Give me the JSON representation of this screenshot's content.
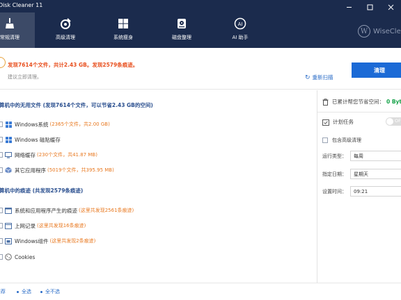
{
  "app": {
    "title": "Disk Cleaner 11"
  },
  "nav": {
    "tabs": [
      {
        "label": "常规清理",
        "icon": "broom-icon"
      },
      {
        "label": "高级清理",
        "icon": "advanced-clean-icon"
      },
      {
        "label": "系统瘦身",
        "icon": "windows-icon"
      },
      {
        "label": "磁盘整理",
        "icon": "disk-icon"
      },
      {
        "label": "AI 助手",
        "icon": "ai-assistant-icon"
      }
    ]
  },
  "brand": {
    "logo_letter": "W",
    "text": "WiseCle"
  },
  "summary": {
    "main": "发现7614个文件，共计2.43 GB。发现2579条痕迹。",
    "sub": "建议立即清理。",
    "rescan_label": "重新扫描",
    "clean_label": "清理"
  },
  "sections": {
    "junk": {
      "title": "算机中的无用文件 (发现7614个文件，可以节省2.43 GB的空间)",
      "items": [
        {
          "name": "Windows系统",
          "detail": "(2365个文件，共2.00 GB)"
        },
        {
          "name": "Windows 磁贴缓存",
          "detail": ""
        },
        {
          "name": "网络缓存",
          "detail": "(230个文件，共41.87 MB)"
        },
        {
          "name": "其它应用程序",
          "detail": "(5019个文件，共395.95 MB)"
        }
      ]
    },
    "traces": {
      "title": "算机中的痕迹 (共发现2579条痕迹)",
      "items": [
        {
          "name": "系统和应用程序产生的痕迹",
          "detail": "(这里共发现2561条痕迹)"
        },
        {
          "name": "上网记录",
          "detail": "(这里共发现16条痕迹)"
        },
        {
          "name": "Windows组件",
          "detail": "(这里共发现2条痕迹)"
        },
        {
          "name": "Cookies",
          "detail": ""
        }
      ]
    }
  },
  "right": {
    "savings_label": "已累计帮您节省空间：",
    "savings_value": "0 Bytes",
    "schedule_label": "计划任务",
    "toggle_text": "OFF",
    "advanced_label": "包含高级清理",
    "fields": [
      {
        "label": "运行类型：",
        "value": "每周"
      },
      {
        "label": "指定日期：",
        "value": "星期天"
      },
      {
        "label": "设置时间：",
        "value": "09:21"
      }
    ]
  },
  "footer": {
    "recommended": "推荐",
    "select_all": "全选",
    "select_none": "全不选"
  }
}
